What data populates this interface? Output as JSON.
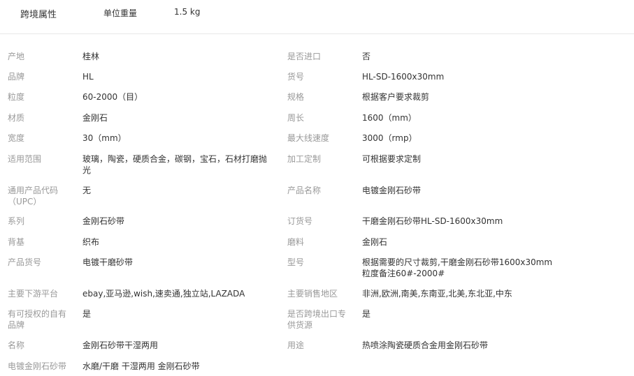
{
  "header": {
    "title": "跨境属性",
    "attr_label": "单位重量",
    "attr_value": "1.5 kg"
  },
  "attributes": [
    {
      "label": "产地",
      "value": "桂林"
    },
    {
      "label": "是否进口",
      "value": "否"
    },
    {
      "label": "品牌",
      "value": "HL"
    },
    {
      "label": "货号",
      "value": "HL-SD-1600x30mm"
    },
    {
      "label": "粒度",
      "value": "60-2000（目）"
    },
    {
      "label": "规格",
      "value": "根据客户要求裁剪"
    },
    {
      "label": "材质",
      "value": "金刚石"
    },
    {
      "label": "周长",
      "value": "1600（mm）"
    },
    {
      "label": "宽度",
      "value": "30（mm）"
    },
    {
      "label": "最大线速度",
      "value": "3000（rmp）"
    },
    {
      "label": "适用范围",
      "value": "玻璃，陶瓷，硬质合金，碳钢，宝石，石材打磨抛光"
    },
    {
      "label": "加工定制",
      "value": "可根据要求定制"
    },
    {
      "label": "通用产品代码（UPC）",
      "value": "无"
    },
    {
      "label": "产品名称",
      "value": "电镀金刚石砂带"
    },
    {
      "label": "系列",
      "value": "金刚石砂带"
    },
    {
      "label": "订货号",
      "value": "干磨金刚石砂带HL-SD-1600x30mm"
    },
    {
      "label": "背基",
      "value": "织布"
    },
    {
      "label": "磨料",
      "value": "金刚石"
    },
    {
      "label": "产品货号",
      "value": "电镀干磨砂带"
    },
    {
      "label": "型号",
      "value": "根据需要的尺寸裁剪,干磨金刚石砂带1600x30mm 粒度备注60#-2000#"
    },
    {
      "label": "主要下游平台",
      "value": "ebay,亚马逊,wish,速卖通,独立站,LAZADA"
    },
    {
      "label": "主要销售地区",
      "value": "非洲,欧洲,南美,东南亚,北美,东北亚,中东"
    },
    {
      "label": "有可授权的自有品牌",
      "value": "是"
    },
    {
      "label": "是否跨境出口专供货源",
      "value": "是"
    },
    {
      "label": "名称",
      "value": "金刚石砂带干湿两用"
    },
    {
      "label": "用途",
      "value": "热喷涂陶瓷硬质合金用金刚石砂带"
    },
    {
      "label": "电镀金刚石砂带",
      "value": "水磨/干磨 干湿两用 金刚石砂带"
    }
  ]
}
